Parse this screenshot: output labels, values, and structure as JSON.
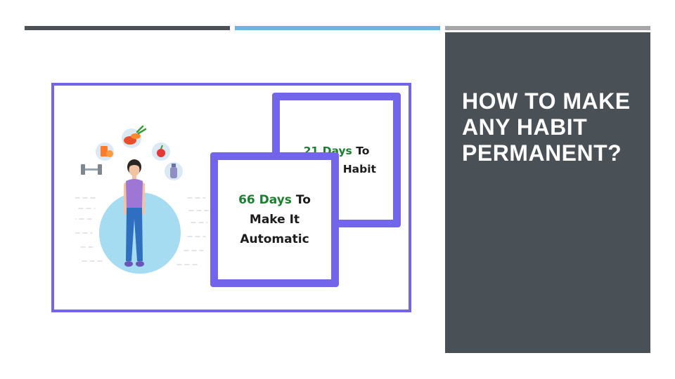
{
  "slide": {
    "title": "HOW TO MAKE ANY HABIT PERMANENT?",
    "accent_colors": {
      "dark": "#4a5157",
      "blue": "#6fb3e0",
      "gray": "#a6a6a6",
      "panel": "#495157",
      "frame": "#7265eb",
      "green": "#1a7f2e"
    }
  },
  "figure": {
    "card_top": {
      "number": "21 Days",
      "word": "To",
      "line2": "Form a Habit"
    },
    "card_bottom": {
      "number": "66 Days",
      "word": "To",
      "line2": "Make It",
      "line3": "Automatic"
    },
    "icons": [
      "orange-juice-icon",
      "vegetables-icon",
      "apple-icon",
      "dumbbell-icon",
      "water-bottle-icon",
      "woman-figure-icon"
    ]
  }
}
